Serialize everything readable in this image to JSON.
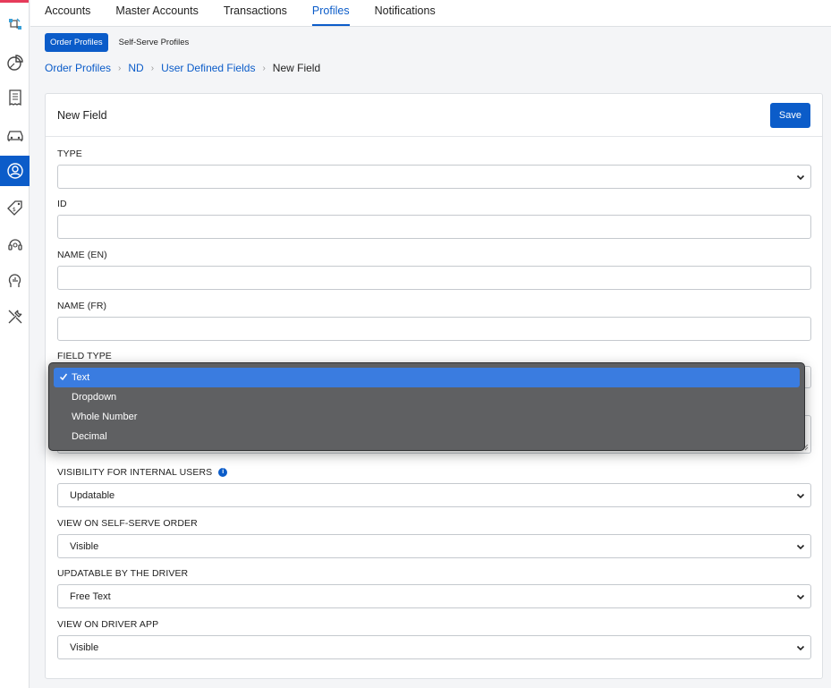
{
  "nav": {
    "tabs": [
      {
        "label": "Accounts"
      },
      {
        "label": "Master Accounts"
      },
      {
        "label": "Transactions"
      },
      {
        "label": "Profiles"
      },
      {
        "label": "Notifications"
      }
    ],
    "active_tab": "Profiles"
  },
  "subtabs": [
    {
      "label": "Order Profiles"
    },
    {
      "label": "Self-Serve Profiles"
    }
  ],
  "breadcrumb": {
    "items": [
      "Order Profiles",
      "ND",
      "User Defined Fields"
    ],
    "current": "New Field",
    "separator": "›"
  },
  "card": {
    "title": "New Field",
    "save_label": "Save"
  },
  "form": {
    "type": {
      "label": "TYPE",
      "value": ""
    },
    "id": {
      "label": "ID",
      "value": ""
    },
    "name_en": {
      "label": "NAME (EN)",
      "value": ""
    },
    "name_fr": {
      "label": "NAME (FR)",
      "value": ""
    },
    "field_type": {
      "label": "FIELD TYPE",
      "options": [
        "Text",
        "Dropdown",
        "Whole Number",
        "Decimal"
      ],
      "selected": "Text"
    },
    "visibility_internal": {
      "label": "VISIBILITY FOR INTERNAL USERS",
      "value": "Updatable"
    },
    "view_self_serve": {
      "label": "VIEW ON SELF-SERVE ORDER",
      "value": "Visible"
    },
    "updatable_driver": {
      "label": "UPDATABLE BY THE DRIVER",
      "value": "Free Text"
    },
    "view_driver_app": {
      "label": "VIEW ON DRIVER APP",
      "value": "Visible"
    }
  },
  "sidebar": {
    "icons": [
      "routing-icon",
      "pie-chart-icon",
      "receipt-icon",
      "car-icon",
      "user-profile-icon",
      "price-tag-icon",
      "headset-icon",
      "analytics-head-icon",
      "tools-icon"
    ],
    "active": "user-profile-icon"
  },
  "colors": {
    "accent": "#0b5cc9",
    "brand_strip": "#e63b5a",
    "dropdown_bg": "#5f6062",
    "dropdown_selected": "#3a7ce0"
  }
}
